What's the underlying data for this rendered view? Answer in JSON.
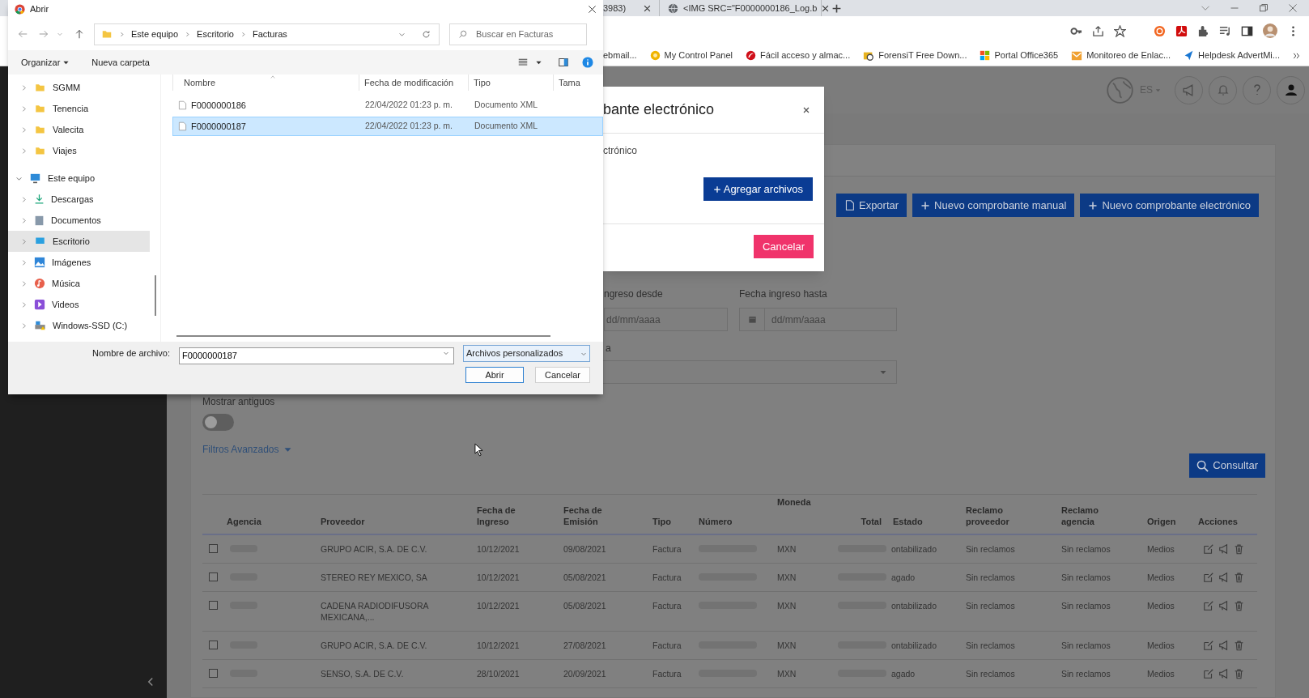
{
  "browser": {
    "tabs": [
      {
        "title": "3983)",
        "kind": "plain"
      },
      {
        "title": "<IMG SRC=\"F0000000186_Log.b",
        "kind": "globe"
      }
    ],
    "bookmarks": [
      {
        "label": "ebmail...",
        "kind": "none"
      },
      {
        "label": "My Control Panel",
        "kind": "dot"
      },
      {
        "label": "Fácil acceso y almac...",
        "kind": "swirl"
      },
      {
        "label": "ForensiT Free Down...",
        "kind": "lens"
      },
      {
        "label": "Portal Office365",
        "kind": "grid"
      },
      {
        "label": "Monitoreo de Enlac...",
        "kind": "mail"
      },
      {
        "label": "Helpdesk AdvertMi...",
        "kind": "shield"
      }
    ]
  },
  "app_header": {
    "language": "ES"
  },
  "toolbar_buttons": [
    {
      "label": "Exportar",
      "kind": "export"
    },
    {
      "label": "Nuevo comprobante manual",
      "kind": "add"
    },
    {
      "label": "Nuevo comprobante electrónico",
      "kind": "add"
    }
  ],
  "filters": {
    "date_from": {
      "label": "ngreso desde",
      "placeholder": "dd/mm/aaaa"
    },
    "date_to": {
      "label": "Fecha ingreso hasta",
      "placeholder": "dd/mm/aaaa"
    },
    "select_label": "a",
    "show_old": {
      "label": "Mostrar antiguos",
      "on": false
    },
    "advanced": "Filtros Avanzados",
    "search_button": "Consultar"
  },
  "table": {
    "columns": [
      "Agencia",
      "Proveedor",
      "Fecha de Ingreso",
      "Fecha de Emisión",
      "Tipo",
      "Número",
      "Moneda",
      "Total",
      "Estado",
      "Reclamo proveedor",
      "Reclamo agencia",
      "Origen",
      "Acciones"
    ],
    "rows": [
      {
        "checked": false,
        "proveedor": "GRUPO ACIR, S.A. DE C.V.",
        "fecha_ingreso": "10/12/2021",
        "fecha_emision": "09/08/2021",
        "tipo": "Factura",
        "moneda": "MXN",
        "estado": "ontabilizado",
        "reclamo_proveedor": "Sin reclamos",
        "reclamo_agencia": "Sin reclamos",
        "origen": "Medios"
      },
      {
        "checked": false,
        "proveedor": "STEREO REY MEXICO, SA",
        "fecha_ingreso": "10/12/2021",
        "fecha_emision": "05/08/2021",
        "tipo": "Factura",
        "moneda": "MXN",
        "estado": "agado",
        "reclamo_proveedor": "Sin reclamos",
        "reclamo_agencia": "Sin reclamos",
        "origen": "Medios"
      },
      {
        "checked": false,
        "proveedor": "CADENA RADIODIFUSORA MEXICANA,...",
        "fecha_ingreso": "10/12/2021",
        "fecha_emision": "05/08/2021",
        "tipo": "Factura",
        "moneda": "MXN",
        "estado": "ontabilizado",
        "reclamo_proveedor": "Sin reclamos",
        "reclamo_agencia": "Sin reclamos",
        "origen": "Medios"
      },
      {
        "checked": false,
        "proveedor": "GRUPO ACIR, S.A. DE C.V.",
        "fecha_ingreso": "10/12/2021",
        "fecha_emision": "27/08/2021",
        "tipo": "Factura",
        "moneda": "MXN",
        "estado": "ontabilizado",
        "reclamo_proveedor": "Sin reclamos",
        "reclamo_agencia": "Sin reclamos",
        "origen": "Medios"
      },
      {
        "checked": false,
        "proveedor": "SENSO, S.A. DE C.V.",
        "fecha_ingreso": "28/10/2021",
        "fecha_emision": "20/09/2021",
        "tipo": "Factura",
        "moneda": "MXN",
        "estado": "agado",
        "reclamo_proveedor": "Sin reclamos",
        "reclamo_agencia": "Sin reclamos",
        "origen": "Medios"
      }
    ]
  },
  "modal": {
    "title": "bante electrónico",
    "body": "ctrónico",
    "add_button": "Agregar archivos",
    "cancel_button": "Cancelar"
  },
  "file_dialog": {
    "title": "Abrir",
    "path": [
      "Este equipo",
      "Escritorio",
      "Facturas"
    ],
    "search_placeholder": "Buscar en Facturas",
    "organize": "Organizar",
    "new_folder": "Nueva carpeta",
    "nav": [
      {
        "label": "SGMM",
        "kind": "folder",
        "expanded": false,
        "selected": false
      },
      {
        "label": "Tenencia",
        "kind": "folder",
        "expanded": false,
        "selected": false
      },
      {
        "label": "Valecita",
        "kind": "folder",
        "expanded": false,
        "selected": false
      },
      {
        "label": "Viajes",
        "kind": "folder",
        "expanded": false,
        "selected": false
      },
      {
        "label": "Este equipo",
        "kind": "pc",
        "expanded": true,
        "selected": false,
        "children": [
          {
            "label": "Descargas",
            "kind": "downloads",
            "expanded": false,
            "selected": false
          },
          {
            "label": "Documentos",
            "kind": "documents",
            "expanded": false,
            "selected": false
          },
          {
            "label": "Escritorio",
            "kind": "desktop",
            "expanded": false,
            "selected": true
          },
          {
            "label": "Imágenes",
            "kind": "images",
            "expanded": false,
            "selected": false
          },
          {
            "label": "Música",
            "kind": "music",
            "expanded": false,
            "selected": false
          },
          {
            "label": "Videos",
            "kind": "videos",
            "expanded": false,
            "selected": false
          },
          {
            "label": "Windows-SSD (C:)",
            "kind": "drive",
            "expanded": false,
            "selected": false
          }
        ]
      }
    ],
    "columns": [
      "Nombre",
      "Fecha de modificación",
      "Tipo",
      "Tama"
    ],
    "files": [
      {
        "name": "F0000000186",
        "modified": "22/04/2022 01:23 p. m.",
        "type": "Documento XML",
        "selected": false
      },
      {
        "name": "F0000000187",
        "modified": "22/04/2022 01:23 p. m.",
        "type": "Documento XML",
        "selected": true
      }
    ],
    "filename_label": "Nombre de archivo:",
    "filename": "F0000000187",
    "filter": "Archivos personalizados",
    "open_button": "Abrir",
    "cancel_button": "Cancelar"
  }
}
